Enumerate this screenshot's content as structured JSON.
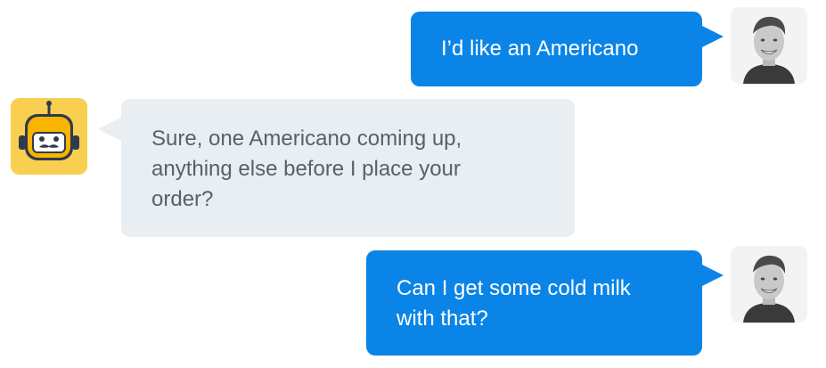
{
  "conversation": {
    "messages": [
      {
        "sender": "user",
        "text": "I’d like an Americano"
      },
      {
        "sender": "bot",
        "text": "Sure, one Americano coming up,\nanything else before I place your\norder?"
      },
      {
        "sender": "user",
        "text": "Can I get some cold milk\nwith that?"
      }
    ]
  },
  "colors": {
    "user_bubble": "#0a84e6",
    "bot_bubble": "#e8eef2",
    "bot_avatar_bg": "#f9cf51",
    "bot_text": "#5a6065"
  },
  "icons": {
    "user_avatar": "user-avatar-icon",
    "bot_avatar": "robot-avatar-icon"
  }
}
